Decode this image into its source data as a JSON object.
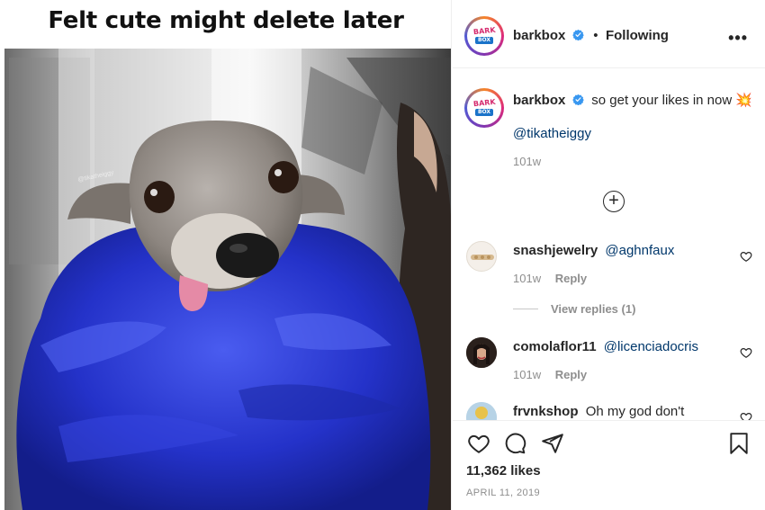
{
  "post": {
    "meme_caption": "Felt cute might delete later",
    "photo_watermark": "@tikatheiggy"
  },
  "header": {
    "avatar_logo_top": "BARK",
    "avatar_logo_bottom": "BOX",
    "username": "barkbox",
    "separator": "•",
    "follow_status": "Following",
    "more_label": "•••"
  },
  "caption": {
    "username": "barkbox",
    "text": "so get your likes in now 💥",
    "mention": "@tikatheiggy",
    "age": "101w",
    "load_more_label": "+"
  },
  "comments": [
    {
      "username": "snashjewelry",
      "text": "@aghnfaux",
      "age": "101w",
      "reply_label": "Reply",
      "view_replies": "View replies (1)"
    },
    {
      "username": "comolaflor11",
      "text": "@licenciadocris",
      "age": "101w",
      "reply_label": "Reply"
    },
    {
      "username": "frvnkshop",
      "text": "Oh my god don't"
    }
  ],
  "footer": {
    "likes": "11,362 likes",
    "date": "APRIL 11, 2019"
  },
  "colors": {
    "fur_blue": "#2432c9",
    "link_blue": "#00376b",
    "verified_blue": "#3897f0",
    "muted_text": "#8e8e8e"
  },
  "icons": [
    "heart-icon",
    "comment-icon",
    "share-icon",
    "bookmark-icon",
    "add-circle-icon",
    "verified-badge-icon",
    "more-icon"
  ]
}
